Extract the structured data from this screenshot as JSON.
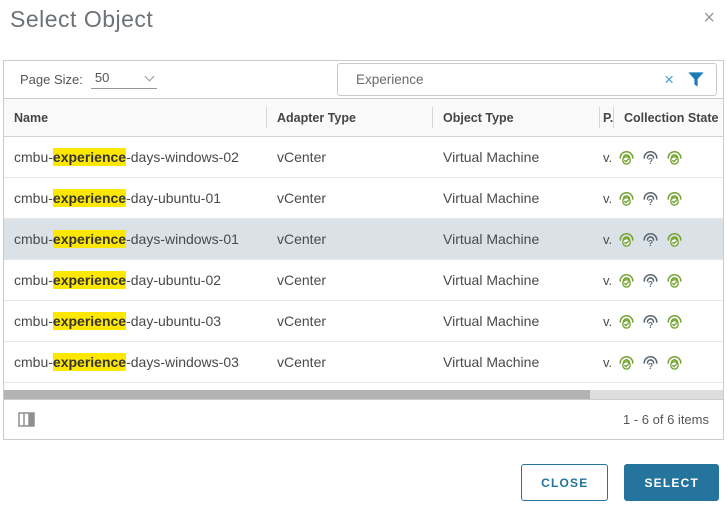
{
  "dialog": {
    "title": "Select Object",
    "close_icon": "×"
  },
  "toolbar": {
    "page_size_label": "Page Size:",
    "page_size_value": "50",
    "search": {
      "value": "Experience",
      "clear_icon": "×",
      "filter_icon": "funnel"
    }
  },
  "table": {
    "columns": [
      "Name",
      "Adapter Type",
      "Object Type",
      "P.",
      "Collection State"
    ],
    "rows": [
      {
        "name_prefix": "cmbu-",
        "name_highlight": "experience",
        "name_suffix": "-days-windows-02",
        "adapter_type": "vCenter",
        "object_type": "Virtual Machine",
        "policy": "v.",
        "collection_states": [
          "collecting-ok",
          "receiving-unknown",
          "collecting-ok"
        ],
        "selected": false
      },
      {
        "name_prefix": "cmbu-",
        "name_highlight": "experience",
        "name_suffix": "-day-ubuntu-01",
        "adapter_type": "vCenter",
        "object_type": "Virtual Machine",
        "policy": "v.",
        "collection_states": [
          "collecting-ok",
          "receiving-unknown",
          "collecting-ok"
        ],
        "selected": false
      },
      {
        "name_prefix": "cmbu-",
        "name_highlight": "experience",
        "name_suffix": "-days-windows-01",
        "adapter_type": "vCenter",
        "object_type": "Virtual Machine",
        "policy": "v.",
        "collection_states": [
          "collecting-ok",
          "receiving-unknown",
          "collecting-ok"
        ],
        "selected": true
      },
      {
        "name_prefix": "cmbu-",
        "name_highlight": "experience",
        "name_suffix": "-day-ubuntu-02",
        "adapter_type": "vCenter",
        "object_type": "Virtual Machine",
        "policy": "v.",
        "collection_states": [
          "collecting-ok",
          "receiving-unknown",
          "collecting-ok"
        ],
        "selected": false
      },
      {
        "name_prefix": "cmbu-",
        "name_highlight": "experience",
        "name_suffix": "-day-ubuntu-03",
        "adapter_type": "vCenter",
        "object_type": "Virtual Machine",
        "policy": "v.",
        "collection_states": [
          "collecting-ok",
          "receiving-unknown",
          "collecting-ok"
        ],
        "selected": false
      },
      {
        "name_prefix": "cmbu-",
        "name_highlight": "experience",
        "name_suffix": "-days-windows-03",
        "adapter_type": "vCenter",
        "object_type": "Virtual Machine",
        "policy": "v.",
        "collection_states": [
          "collecting-ok",
          "receiving-unknown",
          "collecting-ok"
        ],
        "selected": false
      }
    ],
    "footer": {
      "items_text": "1 - 6 of 6 items",
      "column_toggle_icon": "columns"
    }
  },
  "actions": {
    "close_label": "CLOSE",
    "select_label": "SELECT"
  },
  "colors": {
    "primary_button": "#24749e",
    "search_clear_blue": "#44a2d4",
    "filter_blue": "#1b7cb5",
    "highlight_yellow": "#ffe800",
    "collection_ok_green": "#74a333",
    "collection_unknown_gray": "#5b6770",
    "selected_row": "#dae1e7"
  }
}
